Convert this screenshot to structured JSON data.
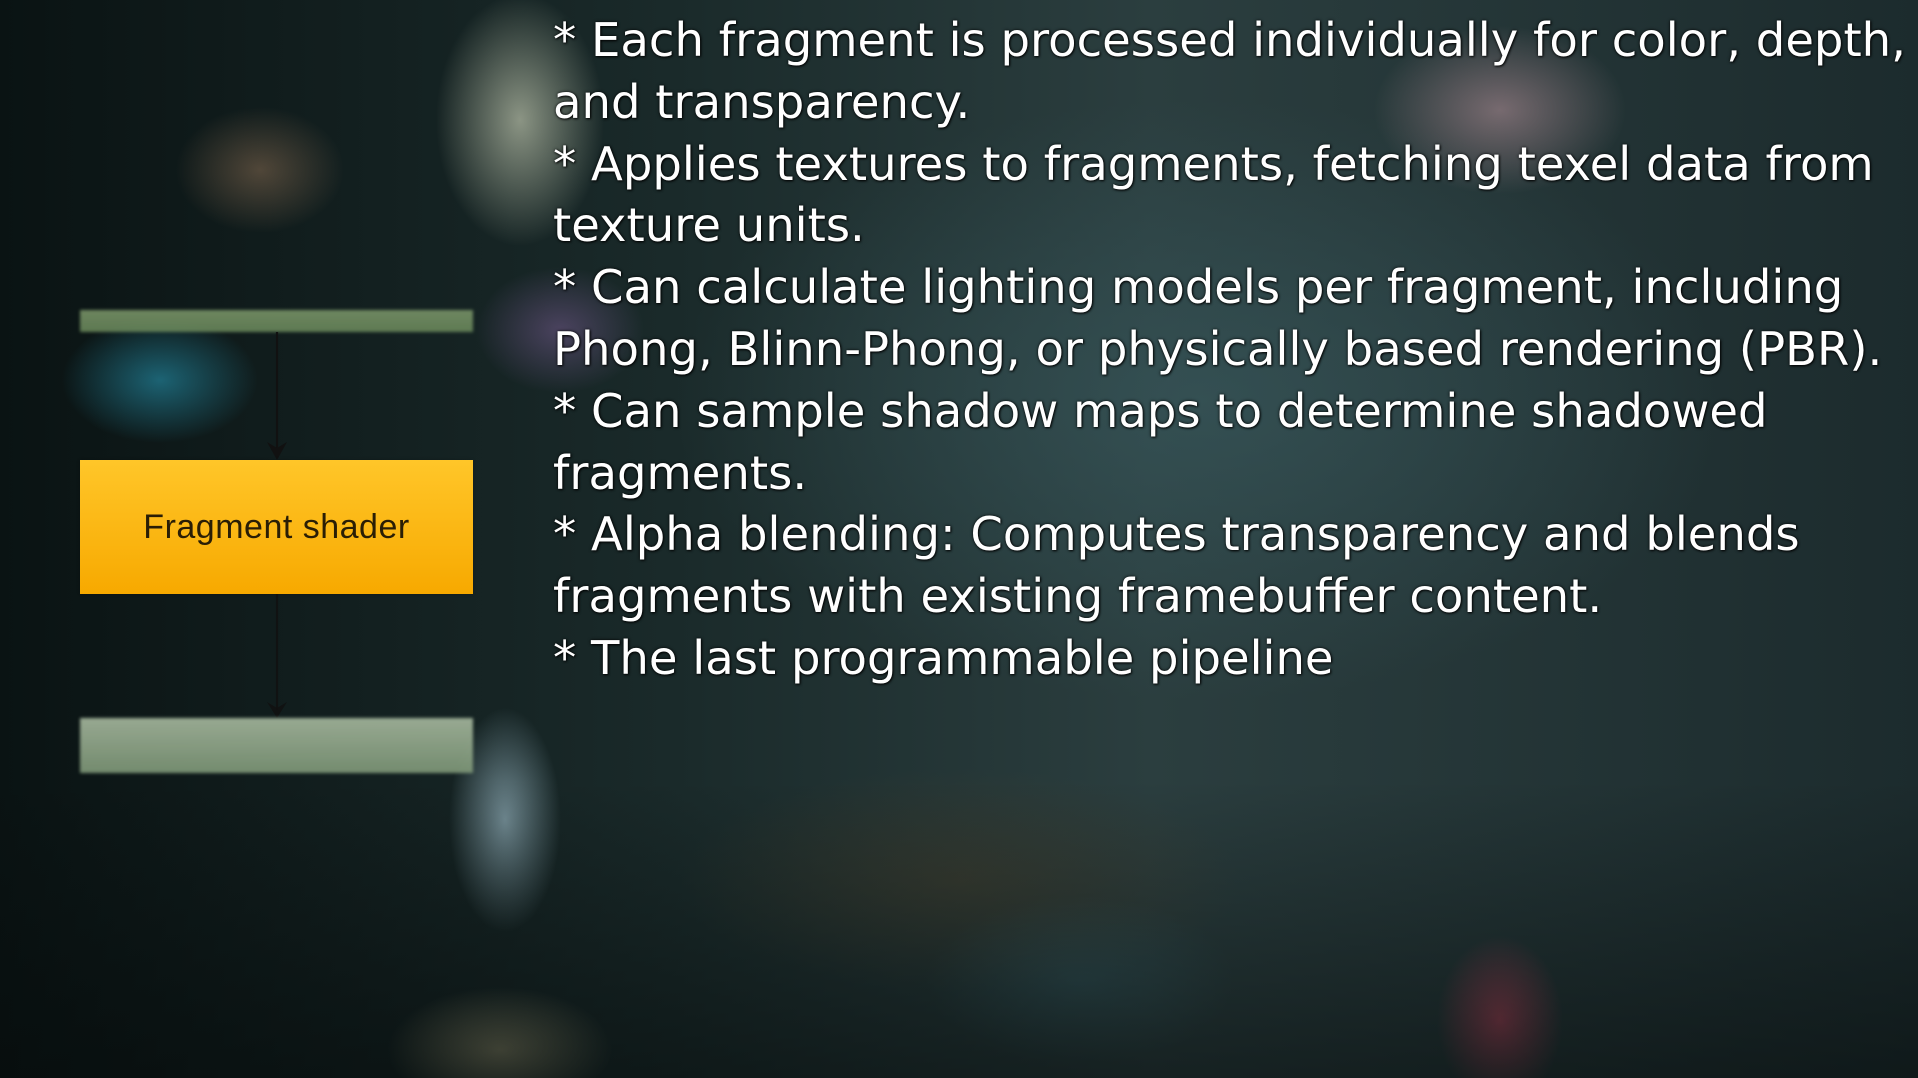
{
  "diagram": {
    "box_label": "Fragment shader",
    "box_color": "#FFB81C",
    "top_bar_color": "#6F8E60",
    "bottom_bar_color": "#93A98A"
  },
  "notes": [
    "* Each fragment is processed individually for color, depth, and transparency.",
    "* Applies textures to fragments, fetching texel data from texture units.",
    "* Can calculate lighting models per fragment, including Phong, Blinn-Phong, or physically based rendering (PBR).",
    "* Can sample shadow maps to determine shadowed fragments.",
    "* Alpha blending: Computes transparency and blends fragments with existing framebuffer content.",
    "* The last programmable pipeline"
  ]
}
